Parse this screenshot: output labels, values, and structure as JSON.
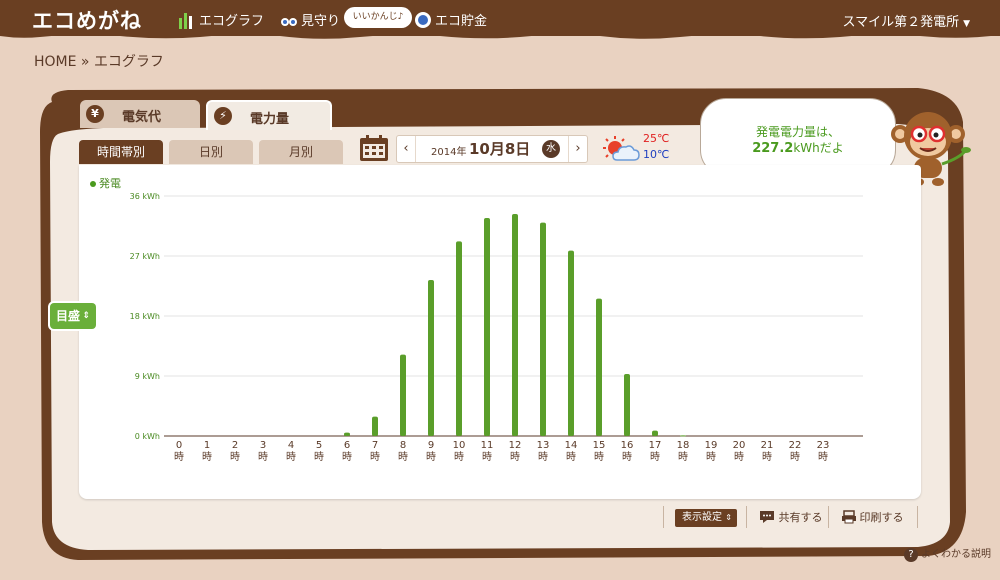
{
  "header": {
    "logo": "エコめがね",
    "nav": [
      {
        "label": "エコグラフ",
        "icon": "bar-graph-icon"
      },
      {
        "label": "見守り",
        "icon": "binoculars-icon"
      },
      {
        "label": "エコ貯金",
        "icon": "coin-icon"
      }
    ],
    "badge": "いいかんじ♪",
    "plant": "スマイル第２発電所"
  },
  "breadcrumb": "HOME » エコグラフ",
  "main_tabs": [
    {
      "label": "電気代",
      "icon": "yen-icon",
      "glyph": "¥"
    },
    {
      "label": "電力量",
      "icon": "lightning-icon",
      "glyph": "⚡"
    }
  ],
  "sub_tabs": [
    "時間帯別",
    "日別",
    "月別"
  ],
  "date": {
    "year": "2014年",
    "month_day": "10月8日",
    "weekday": "水",
    "prev": "‹",
    "next": "›"
  },
  "weather": {
    "high": "25℃",
    "low": "10℃",
    "icon": "sun-cloud-icon"
  },
  "message": {
    "line1": "発電電力量は、",
    "value": "227.2",
    "unit_tail": "kWhだよ"
  },
  "legend": "発電",
  "side_select": "目盛",
  "toolbar": {
    "display": "表示設定",
    "share": "共有する",
    "print": "印刷する"
  },
  "help": "よくわかる説明",
  "colors": {
    "bar": "#5a9e2a",
    "brand_brown": "#6a3f22"
  },
  "chart_data": {
    "type": "bar",
    "categories": [
      "0",
      "1",
      "2",
      "3",
      "4",
      "5",
      "6",
      "7",
      "8",
      "9",
      "10",
      "11",
      "12",
      "13",
      "14",
      "15",
      "16",
      "17",
      "18",
      "19",
      "20",
      "21",
      "22",
      "23"
    ],
    "category_suffix": "時",
    "series": [
      {
        "name": "発電",
        "values": [
          0,
          0,
          0,
          0,
          0,
          0,
          0.5,
          2.9,
          12.2,
          23.4,
          29.2,
          32.7,
          33.3,
          32.0,
          27.8,
          20.6,
          9.3,
          0.8,
          0.1,
          0,
          0,
          0,
          0,
          0
        ]
      }
    ],
    "y_ticks": [
      0,
      9,
      18,
      27,
      36
    ],
    "y_tick_labels": [
      "0 kWh",
      "9 kWh",
      "18 kWh",
      "27 kWh",
      "36 kWh"
    ],
    "ylim": [
      0,
      36
    ],
    "grid": true
  }
}
